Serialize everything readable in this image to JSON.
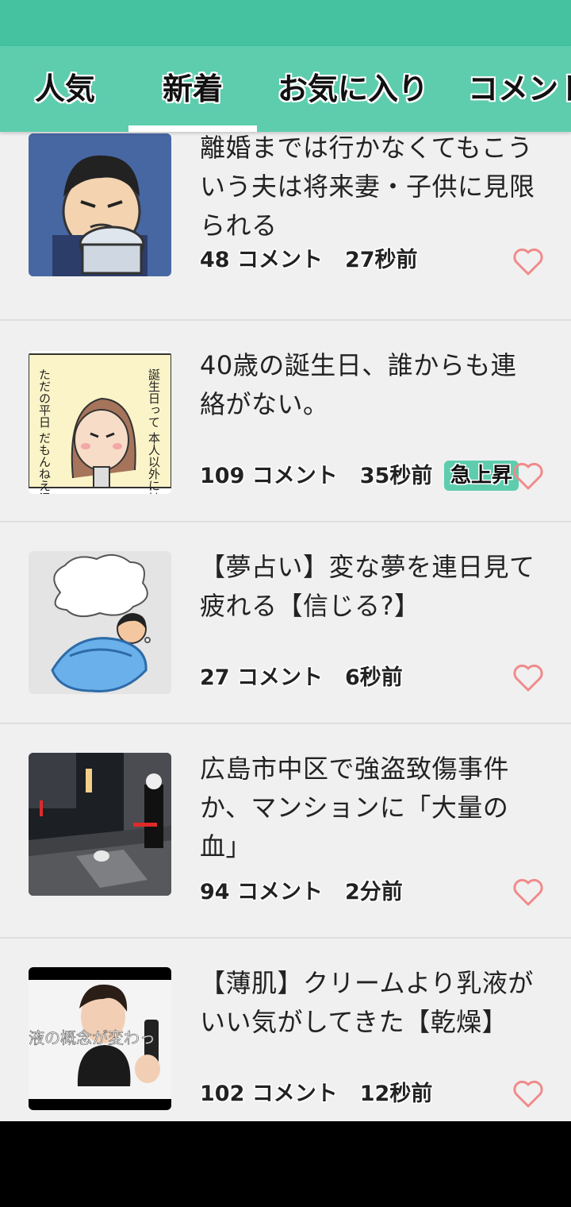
{
  "tabs": [
    {
      "label": "人気"
    },
    {
      "label": "新着"
    },
    {
      "label": "お気に入り"
    },
    {
      "label": "コメント"
    }
  ],
  "active_tab": "新着",
  "theme": {
    "accent": "#5dcdae",
    "status_bar": "#45c3a1",
    "heart": "#f08a8a"
  },
  "items": [
    {
      "title": "離婚までは行かなくてもこういう夫は将来妻・子供に見限られる",
      "comments": "48 コメント",
      "time": "27秒前",
      "badge": ""
    },
    {
      "title": "40歳の誕生日、誰からも連絡がない。",
      "comments": "109 コメント",
      "time": "35秒前",
      "badge": "急上昇"
    },
    {
      "title": "【夢占い】変な夢を連日見て疲れる【信じる?】",
      "comments": "27 コメント",
      "time": "6秒前",
      "badge": ""
    },
    {
      "title": "広島市中区で強盗致傷事件か、マンションに「大量の血」",
      "comments": "94 コメント",
      "time": "2分前",
      "badge": ""
    },
    {
      "title": "【薄肌】クリームより乳液がいい気がしてきた【乾燥】",
      "comments": "102 コメント",
      "time": "12秒前",
      "badge": ""
    }
  ],
  "thumb_text": {
    "manga_caption_right": "誕生日って 本人以外には",
    "manga_caption_left": "ただの平日 だもんねえ!",
    "video_caption": "液の概念が変わっ"
  },
  "icons": {
    "favorite": "heart-outline-icon"
  }
}
